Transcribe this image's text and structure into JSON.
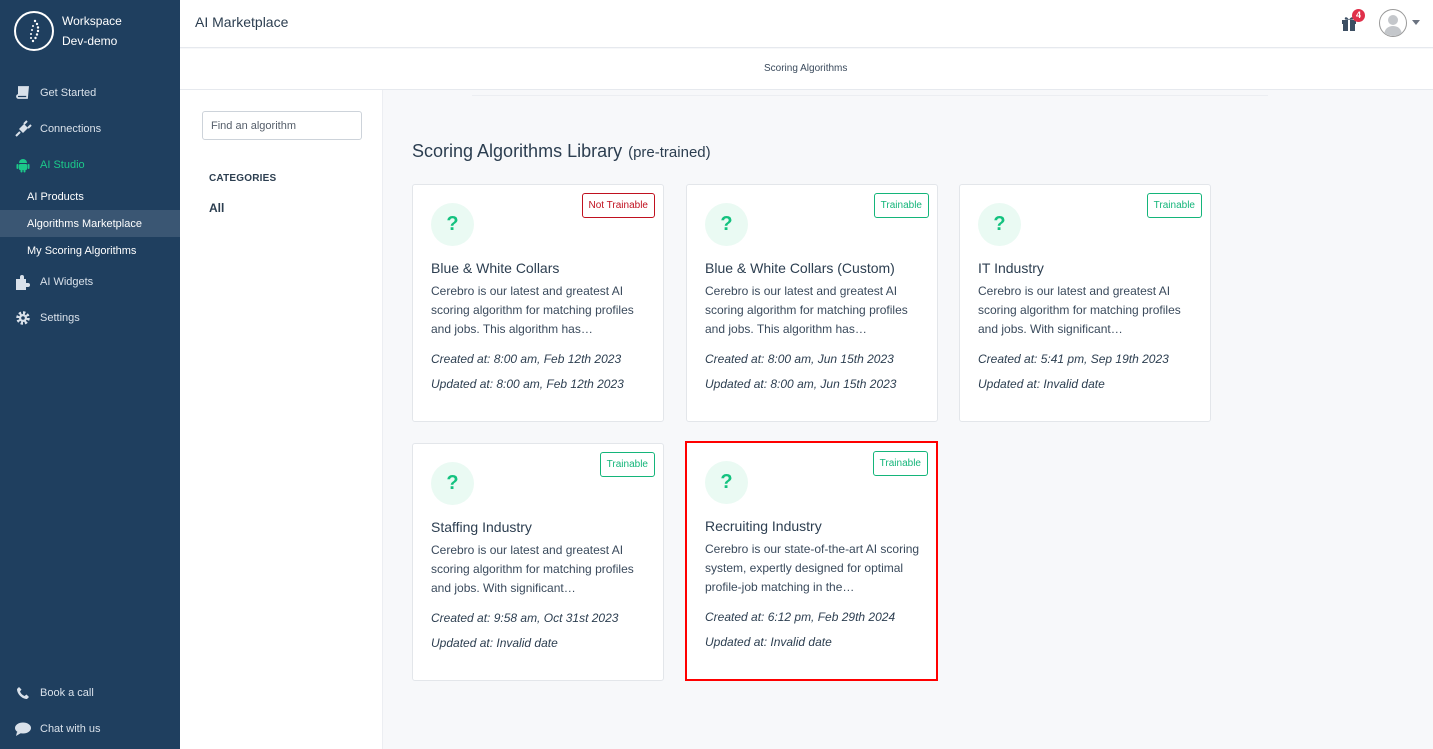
{
  "sidebar": {
    "workspace_label": "Workspace",
    "workspace_name": "Dev-demo",
    "items": [
      {
        "label": "Get Started",
        "icon": "book-icon"
      },
      {
        "label": "Connections",
        "icon": "plug-icon"
      },
      {
        "label": "AI Studio",
        "icon": "android-icon",
        "active": true
      },
      {
        "label": "AI Widgets",
        "icon": "puzzle-icon"
      },
      {
        "label": "Settings",
        "icon": "gear-icon"
      }
    ],
    "ai_studio_sub": [
      {
        "label": "AI Products"
      },
      {
        "label": "Algorithms Marketplace",
        "selected": true
      },
      {
        "label": "My Scoring Algorithms"
      }
    ],
    "bottom": [
      {
        "label": "Book a call",
        "icon": "phone-icon"
      },
      {
        "label": "Chat with us",
        "icon": "chat-icon"
      }
    ]
  },
  "header": {
    "title": "AI Marketplace",
    "notification_count": "4"
  },
  "subheader": {
    "tab": "Scoring Algorithms"
  },
  "filter": {
    "search_placeholder": "Find an algorithm",
    "categories_label": "CATEGORIES",
    "categories": [
      "All"
    ]
  },
  "main": {
    "title": "Scoring Algorithms Library",
    "subtitle": "(pre-trained)",
    "cards": [
      {
        "name": "Blue & White Collars",
        "tag": "Not Trainable",
        "trainable": false,
        "description": "Cerebro is our latest and greatest AI scoring algorithm for matching profiles and jobs. This algorithm has…",
        "created": "Created at: 8:00 am, Feb 12th 2023",
        "updated": "Updated at: 8:00 am, Feb 12th 2023"
      },
      {
        "name": "Blue & White Collars (Custom)",
        "tag": "Trainable",
        "trainable": true,
        "description": "Cerebro is our latest and greatest AI scoring algorithm for matching profiles and jobs. This algorithm has…",
        "created": "Created at: 8:00 am, Jun 15th 2023",
        "updated": "Updated at: 8:00 am, Jun 15th 2023"
      },
      {
        "name": "IT Industry",
        "tag": "Trainable",
        "trainable": true,
        "description": "Cerebro is our latest and greatest AI scoring algorithm for matching profiles and jobs. With significant…",
        "created": "Created at: 5:41 pm, Sep 19th 2023",
        "updated": "Updated at: Invalid date"
      },
      {
        "name": "Staffing Industry",
        "tag": "Trainable",
        "trainable": true,
        "description": "Cerebro is our latest and greatest AI scoring algorithm for matching profiles and jobs. With significant…",
        "created": "Created at: 9:58 am, Oct 31st 2023",
        "updated": "Updated at: Invalid date"
      },
      {
        "name": "Recruiting Industry",
        "tag": "Trainable",
        "trainable": true,
        "highlighted": true,
        "description": "Cerebro is our state-of-the-art AI scoring system, expertly designed for optimal profile-job matching in the…",
        "created": "Created at: 6:12 pm, Feb 29th 2024",
        "updated": "Updated at: Invalid date"
      }
    ],
    "card_icon": "question-icon",
    "card_icon_glyph": "?"
  },
  "colors": {
    "sidebar_bg": "#1f3f5f",
    "accent_green": "#14c27f",
    "not_trainable_red": "#c0111f",
    "highlight_red": "#ff0000",
    "badge_red": "#e0304a"
  }
}
